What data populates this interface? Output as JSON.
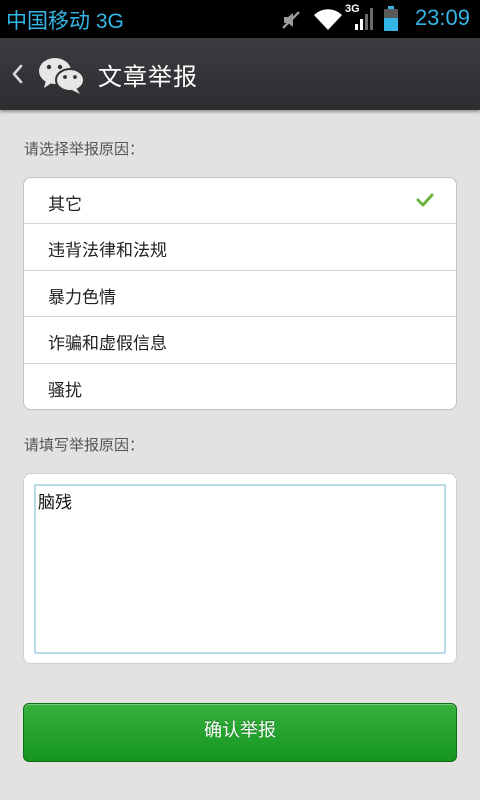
{
  "status_bar": {
    "carrier": "中国移动 3G",
    "network_badge": "3G",
    "time": "23:09",
    "icons": [
      "mute-icon",
      "wifi-icon",
      "signal-icon",
      "battery-icon"
    ],
    "accent": "#33b5e5"
  },
  "title_bar": {
    "title": "文章举报",
    "icons": [
      "back-chevron-icon",
      "wechat-logo-icon"
    ]
  },
  "form": {
    "choose_label": "请选择举报原因：",
    "options": [
      {
        "label": "其它",
        "selected": true
      },
      {
        "label": "违背法律和法规",
        "selected": false
      },
      {
        "label": "暴力色情",
        "selected": false
      },
      {
        "label": "诈骗和虚假信息",
        "selected": false
      },
      {
        "label": "骚扰",
        "selected": false
      }
    ],
    "check_color": "#6db33f",
    "fill_label": "请填写举报原因：",
    "reason_value": "脑残",
    "submit_label": "确认举报",
    "submit_color": "#1fa22a"
  }
}
